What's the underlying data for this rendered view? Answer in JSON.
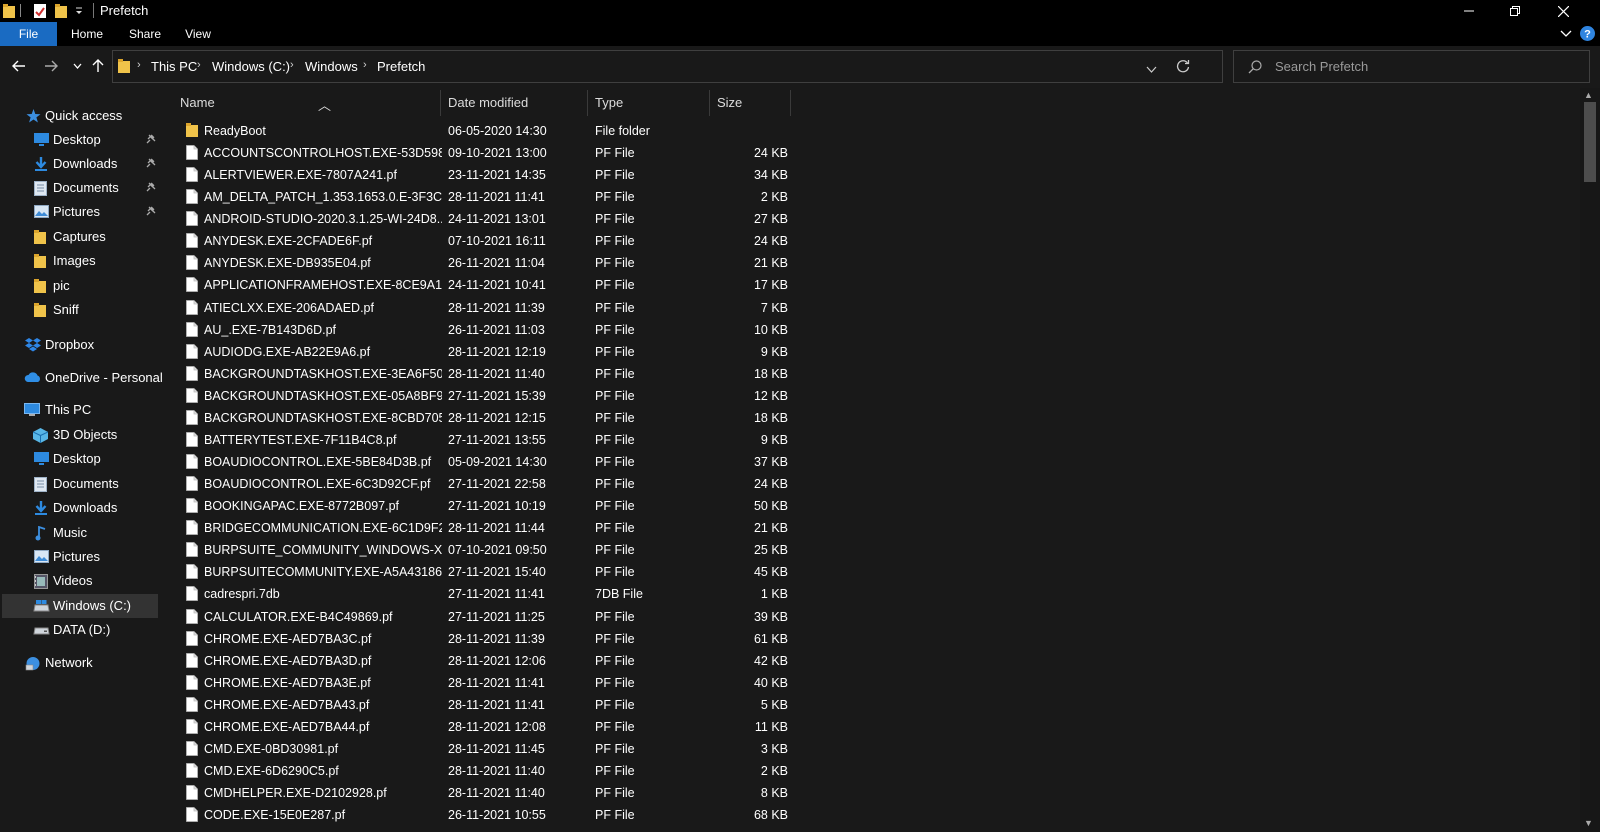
{
  "window": {
    "title": "Prefetch",
    "quick_access_toolbar": [
      "folder-icon",
      "properties-icon",
      "new-folder-icon",
      "customize-dropdown-icon"
    ],
    "controls": [
      "minimize-icon",
      "restore-icon",
      "close-icon"
    ]
  },
  "ribbon": {
    "tabs": [
      {
        "label": "File"
      },
      {
        "label": "Home"
      },
      {
        "label": "Share"
      },
      {
        "label": "View"
      }
    ]
  },
  "address": {
    "crumbs": [
      "This PC",
      "Windows (C:)",
      "Windows",
      "Prefetch"
    ]
  },
  "search": {
    "placeholder": "Search Prefetch"
  },
  "nav": {
    "quick_access": {
      "label": "Quick access"
    },
    "quick_items": [
      {
        "label": "Desktop",
        "icon": "desktop-icon",
        "pinned": true
      },
      {
        "label": "Downloads",
        "icon": "downloads-icon",
        "pinned": true
      },
      {
        "label": "Documents",
        "icon": "documents-icon",
        "pinned": true
      },
      {
        "label": "Pictures",
        "icon": "pictures-icon",
        "pinned": true
      },
      {
        "label": "Captures",
        "icon": "folder-icon",
        "pinned": false
      },
      {
        "label": "Images",
        "icon": "folder-icon",
        "pinned": false
      },
      {
        "label": "pic",
        "icon": "folder-icon",
        "pinned": false
      },
      {
        "label": "Sniff",
        "icon": "folder-icon",
        "pinned": false
      }
    ],
    "dropbox": {
      "label": "Dropbox"
    },
    "onedrive": {
      "label": "OneDrive - Personal"
    },
    "this_pc": {
      "label": "This PC"
    },
    "pc_items": [
      {
        "label": "3D Objects",
        "icon": "3d-objects-icon"
      },
      {
        "label": "Desktop",
        "icon": "desktop-icon"
      },
      {
        "label": "Documents",
        "icon": "documents-icon"
      },
      {
        "label": "Downloads",
        "icon": "downloads-icon"
      },
      {
        "label": "Music",
        "icon": "music-icon"
      },
      {
        "label": "Pictures",
        "icon": "pictures-icon"
      },
      {
        "label": "Videos",
        "icon": "videos-icon"
      },
      {
        "label": "Windows (C:)",
        "icon": "drive-c-icon"
      },
      {
        "label": "DATA (D:)",
        "icon": "drive-icon"
      }
    ],
    "network": {
      "label": "Network"
    }
  },
  "columns": {
    "name": "Name",
    "date": "Date modified",
    "type": "Type",
    "size": "Size"
  },
  "files": [
    {
      "name": "ReadyBoot",
      "date": "06-05-2020 14:30",
      "type": "File folder",
      "size": "",
      "icon": "folder-icon"
    },
    {
      "name": "ACCOUNTSCONTROLHOST.EXE-53D5987...",
      "date": "09-10-2021 13:00",
      "type": "PF File",
      "size": "24 KB",
      "icon": "file-icon"
    },
    {
      "name": "ALERTVIEWER.EXE-7807A241.pf",
      "date": "23-11-2021 14:35",
      "type": "PF File",
      "size": "34 KB",
      "icon": "file-icon"
    },
    {
      "name": "AM_DELTA_PATCH_1.353.1653.0.E-3F3C25...",
      "date": "28-11-2021 11:41",
      "type": "PF File",
      "size": "2 KB",
      "icon": "file-icon"
    },
    {
      "name": "ANDROID-STUDIO-2020.3.1.25-WI-24D8...",
      "date": "24-11-2021 13:01",
      "type": "PF File",
      "size": "27 KB",
      "icon": "file-icon"
    },
    {
      "name": "ANYDESK.EXE-2CFADE6F.pf",
      "date": "07-10-2021 16:11",
      "type": "PF File",
      "size": "24 KB",
      "icon": "file-icon"
    },
    {
      "name": "ANYDESK.EXE-DB935E04.pf",
      "date": "26-11-2021 11:04",
      "type": "PF File",
      "size": "21 KB",
      "icon": "file-icon"
    },
    {
      "name": "APPLICATIONFRAMEHOST.EXE-8CE9A1E...",
      "date": "24-11-2021 10:41",
      "type": "PF File",
      "size": "17 KB",
      "icon": "file-icon"
    },
    {
      "name": "ATIECLXX.EXE-206ADAED.pf",
      "date": "28-11-2021 11:39",
      "type": "PF File",
      "size": "7 KB",
      "icon": "file-icon"
    },
    {
      "name": "AU_.EXE-7B143D6D.pf",
      "date": "26-11-2021 11:03",
      "type": "PF File",
      "size": "10 KB",
      "icon": "file-icon"
    },
    {
      "name": "AUDIODG.EXE-AB22E9A6.pf",
      "date": "28-11-2021 12:19",
      "type": "PF File",
      "size": "9 KB",
      "icon": "file-icon"
    },
    {
      "name": "BACKGROUNDTASKHOST.EXE-3EA6F507....",
      "date": "28-11-2021 11:40",
      "type": "PF File",
      "size": "18 KB",
      "icon": "file-icon"
    },
    {
      "name": "BACKGROUNDTASKHOST.EXE-05A8BF9D...",
      "date": "27-11-2021 15:39",
      "type": "PF File",
      "size": "12 KB",
      "icon": "file-icon"
    },
    {
      "name": "BACKGROUNDTASKHOST.EXE-8CBD7053...",
      "date": "28-11-2021 12:15",
      "type": "PF File",
      "size": "18 KB",
      "icon": "file-icon"
    },
    {
      "name": "BATTERYTEST.EXE-7F11B4C8.pf",
      "date": "27-11-2021 13:55",
      "type": "PF File",
      "size": "9 KB",
      "icon": "file-icon"
    },
    {
      "name": "BOAUDIOCONTROL.EXE-5BE84D3B.pf",
      "date": "05-09-2021 14:30",
      "type": "PF File",
      "size": "37 KB",
      "icon": "file-icon"
    },
    {
      "name": "BOAUDIOCONTROL.EXE-6C3D92CF.pf",
      "date": "27-11-2021 22:58",
      "type": "PF File",
      "size": "24 KB",
      "icon": "file-icon"
    },
    {
      "name": "BOOKINGAPAC.EXE-8772B097.pf",
      "date": "27-11-2021 10:19",
      "type": "PF File",
      "size": "50 KB",
      "icon": "file-icon"
    },
    {
      "name": "BRIDGECOMMUNICATION.EXE-6C1D9F2...",
      "date": "28-11-2021 11:44",
      "type": "PF File",
      "size": "21 KB",
      "icon": "file-icon"
    },
    {
      "name": "BURPSUITE_COMMUNITY_WINDOWS-X-...",
      "date": "07-10-2021 09:50",
      "type": "PF File",
      "size": "25 KB",
      "icon": "file-icon"
    },
    {
      "name": "BURPSUITECOMMUNITY.EXE-A5A43186.pf",
      "date": "27-11-2021 15:40",
      "type": "PF File",
      "size": "45 KB",
      "icon": "file-icon"
    },
    {
      "name": "cadrespri.7db",
      "date": "27-11-2021 11:41",
      "type": "7DB File",
      "size": "1 KB",
      "icon": "file-icon"
    },
    {
      "name": "CALCULATOR.EXE-B4C49869.pf",
      "date": "27-11-2021 11:25",
      "type": "PF File",
      "size": "39 KB",
      "icon": "file-icon"
    },
    {
      "name": "CHROME.EXE-AED7BA3C.pf",
      "date": "28-11-2021 11:39",
      "type": "PF File",
      "size": "61 KB",
      "icon": "file-icon"
    },
    {
      "name": "CHROME.EXE-AED7BA3D.pf",
      "date": "28-11-2021 12:06",
      "type": "PF File",
      "size": "42 KB",
      "icon": "file-icon"
    },
    {
      "name": "CHROME.EXE-AED7BA3E.pf",
      "date": "28-11-2021 11:41",
      "type": "PF File",
      "size": "40 KB",
      "icon": "file-icon"
    },
    {
      "name": "CHROME.EXE-AED7BA43.pf",
      "date": "28-11-2021 11:41",
      "type": "PF File",
      "size": "5 KB",
      "icon": "file-icon"
    },
    {
      "name": "CHROME.EXE-AED7BA44.pf",
      "date": "28-11-2021 12:08",
      "type": "PF File",
      "size": "11 KB",
      "icon": "file-icon"
    },
    {
      "name": "CMD.EXE-0BD30981.pf",
      "date": "28-11-2021 11:45",
      "type": "PF File",
      "size": "3 KB",
      "icon": "file-icon"
    },
    {
      "name": "CMD.EXE-6D6290C5.pf",
      "date": "28-11-2021 11:40",
      "type": "PF File",
      "size": "2 KB",
      "icon": "file-icon"
    },
    {
      "name": "CMDHELPER.EXE-D2102928.pf",
      "date": "28-11-2021 11:40",
      "type": "PF File",
      "size": "8 KB",
      "icon": "file-icon"
    },
    {
      "name": "CODE.EXE-15E0E287.pf",
      "date": "26-11-2021 10:55",
      "type": "PF File",
      "size": "68 KB",
      "icon": "file-icon"
    }
  ],
  "colors": {
    "accent": "#1a6bc2",
    "background": "#191919",
    "folder": "#f0c34a",
    "help": "#2f84df",
    "selection": "#333333"
  }
}
